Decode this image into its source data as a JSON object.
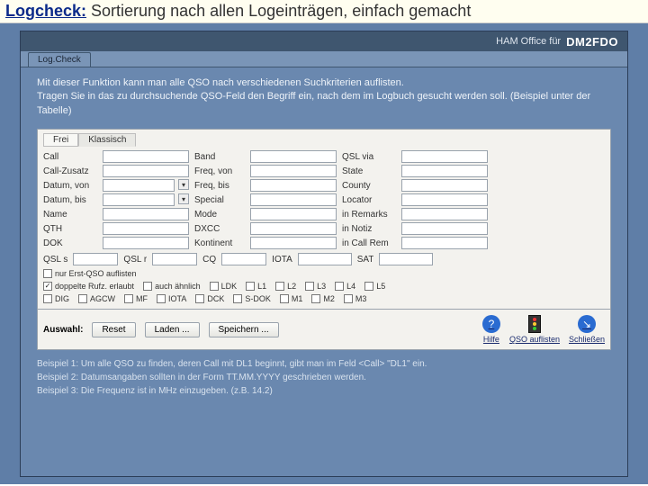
{
  "title": {
    "em": "Logcheck:",
    "rest": " Sortierung nach allen Logeinträgen, einfach gemacht"
  },
  "topbar": {
    "appfor": "HAM Office für",
    "callsign": "DM2FDO"
  },
  "tab": "Log.Check",
  "intro": {
    "l1": "Mit dieser Funktion kann man alle QSO nach verschiedenen Suchkriterien auflisten.",
    "l2": "Tragen Sie in das zu durchsuchende QSO-Feld den Begriff ein, nach dem im Logbuch gesucht werden soll. (Beispiel unter der Tabelle)"
  },
  "ptabs": {
    "free": "Frei",
    "classic": "Klassisch"
  },
  "fields": {
    "c1": [
      "Call",
      "Call-Zusatz",
      "Datum, von",
      "Datum, bis",
      "Name",
      "QTH",
      "DOK"
    ],
    "c2": [
      "Band",
      "Freq, von",
      "Freq, bis",
      "Special",
      "Mode",
      "DXCC",
      "Kontinent"
    ],
    "c3": [
      "QSL via",
      "State",
      "County",
      "Locator",
      "in Remarks",
      "in Notiz",
      "in Call Rem"
    ]
  },
  "subrow": {
    "a": "QSL s",
    "b": "QSL r",
    "c": "CQ",
    "d": "IOTA",
    "e": "SAT"
  },
  "checks": {
    "erst": "nur Erst-QSO auflisten",
    "dop": "doppelte Rufz. erlaubt",
    "aehn": "auch ähnlich",
    "ldk": "LDK",
    "l1": "L1",
    "l2": "L2",
    "l3": "L3",
    "l4": "L4",
    "l5": "L5",
    "dig": "DIG",
    "agcw": "AGCW",
    "mf": "MF",
    "iota": "IOTA",
    "dck": "DCK",
    "sdok": "S-DOK",
    "m1": "M1",
    "m2": "M2",
    "m3": "M3"
  },
  "actions": {
    "auswahl": "Auswahl:",
    "reset": "Reset",
    "laden": "Laden ...",
    "speichern": "Speichern ...",
    "hilfe": "Hilfe",
    "auflisten": "QSO auflisten",
    "schliessen": "Schließen"
  },
  "examples": {
    "e1": "Beispiel 1: Um alle QSO zu finden, deren Call mit DL1 beginnt, gibt man im Feld <Call> \"DL1\" ein.",
    "e2": "Beispiel 2: Datumsangaben sollten in der Form TT.MM.YYYY geschrieben werden.",
    "e3": "Beispiel 3: Die Frequenz ist in MHz einzugeben. (z.B. 14.2)"
  }
}
